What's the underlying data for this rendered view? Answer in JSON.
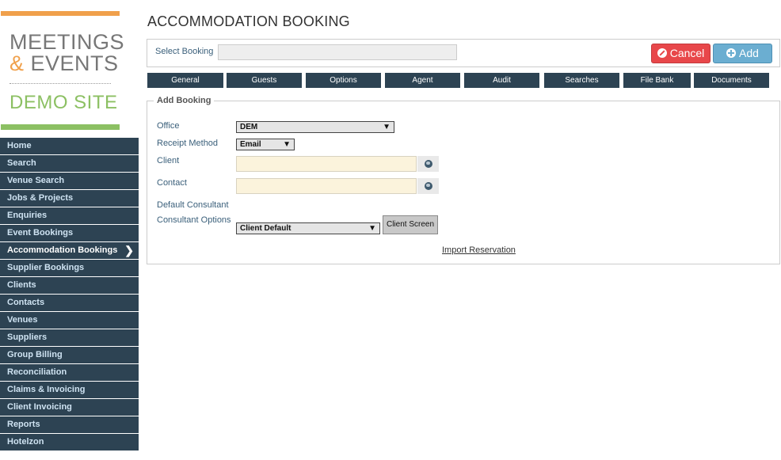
{
  "logo": {
    "line1": "MEETINGS",
    "line2_amp": "&",
    "line2_rest": " EVENTS",
    "line3": "DEMO SITE",
    "colors": {
      "orange": "#f0a04b",
      "green": "#8cc063",
      "grey": "#777777"
    }
  },
  "sidebar": {
    "items": [
      {
        "label": "Home"
      },
      {
        "label": "Search"
      },
      {
        "label": "Venue Search"
      },
      {
        "label": "Jobs & Projects"
      },
      {
        "label": "Enquiries"
      },
      {
        "label": "Event Bookings"
      },
      {
        "label": "Accommodation Bookings",
        "active": true
      },
      {
        "label": "Supplier Bookings"
      },
      {
        "label": "Clients"
      },
      {
        "label": "Contacts"
      },
      {
        "label": "Venues"
      },
      {
        "label": "Suppliers"
      },
      {
        "label": "Group Billing"
      },
      {
        "label": "Reconciliation"
      },
      {
        "label": "Claims & Invoicing"
      },
      {
        "label": "Client Invoicing"
      },
      {
        "label": "Reports"
      },
      {
        "label": "Hotelzon"
      }
    ],
    "active_chevron": "❯",
    "bg_color": "#2d4353"
  },
  "page": {
    "title": "ACCOMMODATION BOOKING"
  },
  "booking_select": {
    "label": "Select Booking",
    "value": "",
    "cancel_label": "Cancel",
    "add_label": "Add",
    "cancel_icon": "ban-icon",
    "add_icon": "plus-circle-icon",
    "cancel_color": "#e8474a",
    "add_color": "#6baed1"
  },
  "tabs": [
    {
      "label": "General"
    },
    {
      "label": "Guests"
    },
    {
      "label": "Options"
    },
    {
      "label": "Agent"
    },
    {
      "label": "Audit"
    },
    {
      "label": "Searches"
    },
    {
      "label": "File Bank"
    },
    {
      "label": "Documents"
    }
  ],
  "add_booking": {
    "legend": "Add Booking",
    "office": {
      "label": "Office",
      "value": "DEM"
    },
    "receipt_method": {
      "label": "Receipt Method",
      "value": "Email"
    },
    "client": {
      "label": "Client",
      "value": "",
      "icon": "globe-icon"
    },
    "contact": {
      "label": "Contact",
      "value": "",
      "icon": "globe-icon"
    },
    "default_consultant": {
      "label": "Default Consultant"
    },
    "consultant_options": {
      "label": "Consultant Options",
      "value": "Client Default"
    },
    "client_screen_label": "Client Screen",
    "import_link": "Import Reservation"
  }
}
